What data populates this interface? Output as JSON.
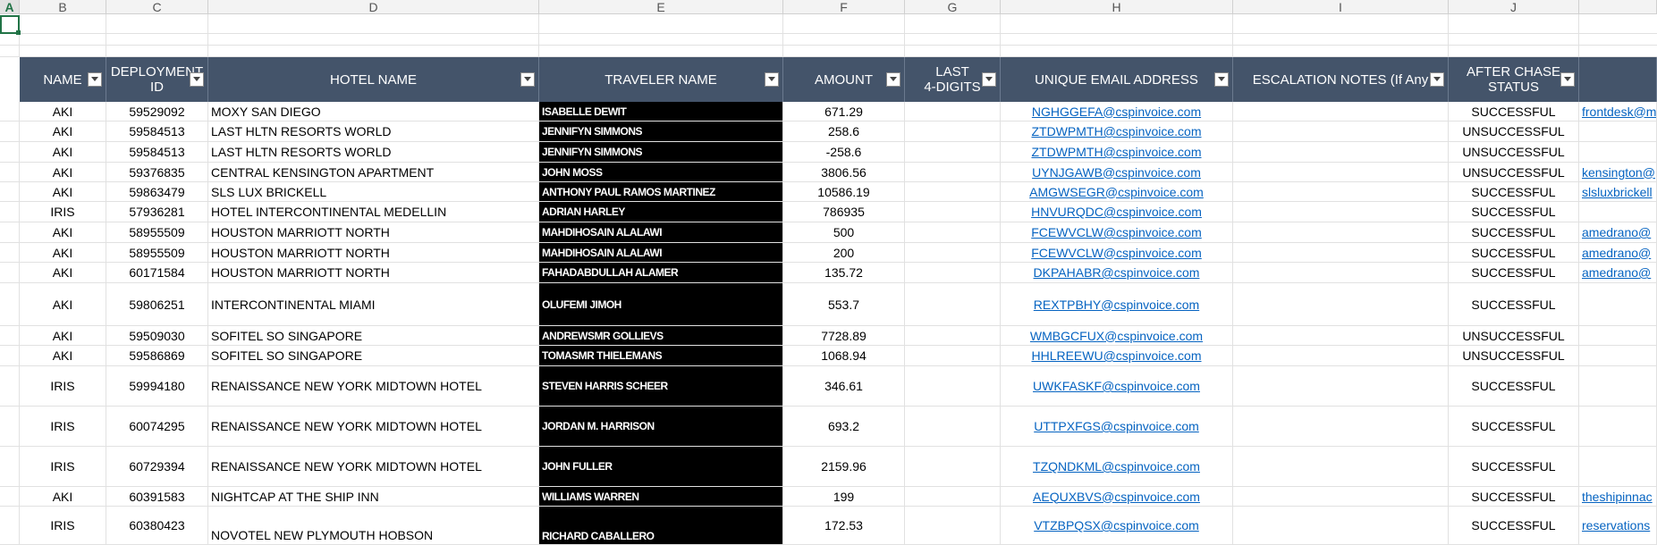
{
  "column_letters": [
    "A",
    "B",
    "C",
    "D",
    "E",
    "F",
    "G",
    "H",
    "I",
    "J"
  ],
  "table": {
    "headers": [
      {
        "key": "name",
        "label": "NAME"
      },
      {
        "key": "deployment",
        "label": "DEPLOYMENT\nID"
      },
      {
        "key": "hotel",
        "label": "HOTEL NAME"
      },
      {
        "key": "traveler",
        "label": "TRAVELER NAME"
      },
      {
        "key": "amount",
        "label": "AMOUNT"
      },
      {
        "key": "last4",
        "label": "LAST\n4-DIGITS"
      },
      {
        "key": "email",
        "label": "UNIQUE EMAIL ADDRESS"
      },
      {
        "key": "escalation",
        "label": "ESCALATION NOTES (If Any"
      },
      {
        "key": "status",
        "label": "AFTER CHASE\nSTATUS"
      },
      {
        "key": "extra",
        "label": ""
      }
    ],
    "rows": [
      {
        "name": "AKI",
        "id": "59529092",
        "hotel": "MOXY SAN DIEGO",
        "traveler": "ISABELLE DEWIT",
        "amount": "671.29",
        "email": "NGHGGEFA@cspinvoice.com",
        "status": "SUCCESSFUL",
        "contact": "frontdesk@m"
      },
      {
        "name": "AKI",
        "id": "59584513",
        "hotel": "LAST HLTN RESORTS WORLD",
        "traveler": "JENNIFYN SIMMONS",
        "amount": "258.6",
        "email": "ZTDWPMTH@cspinvoice.com",
        "status": "UNSUCCESSFUL",
        "contact": ""
      },
      {
        "name": "AKI",
        "id": "59584513",
        "hotel": "LAST HLTN RESORTS WORLD",
        "traveler": "JENNIFYN SIMMONS",
        "amount": "-258.6",
        "email": "ZTDWPMTH@cspinvoice.com",
        "status": "UNSUCCESSFUL",
        "contact": ""
      },
      {
        "name": "AKI",
        "id": "59376835",
        "hotel": "CENTRAL KENSINGTON APARTMENT",
        "traveler": "JOHN MOSS",
        "amount": "3806.56",
        "email": "UYNJGAWB@cspinvoice.com",
        "status": "UNSUCCESSFUL",
        "contact": "kensington@"
      },
      {
        "name": "AKI",
        "id": "59863479",
        "hotel": "SLS LUX BRICKELL",
        "traveler": "ANTHONY PAUL RAMOS MARTINEZ",
        "amount": "10586.19",
        "email": "AMGWSEGR@cspinvoice.com",
        "status": "SUCCESSFUL",
        "contact": "slsluxbrickell"
      },
      {
        "name": "IRIS",
        "id": "57936281",
        "hotel": "HOTEL INTERCONTINENTAL MEDELLIN",
        "traveler": "ADRIAN HARLEY",
        "amount": "786935",
        "email": "HNVURQDC@cspinvoice.com",
        "status": "SUCCESSFUL",
        "contact": ""
      },
      {
        "name": "AKI",
        "id": "58955509",
        "hotel": "HOUSTON MARRIOTT NORTH",
        "traveler": "MAHDIHOSAIN ALALAWI",
        "amount": "500",
        "email": "FCEWVCLW@cspinvoice.com",
        "status": "SUCCESSFUL",
        "contact": "amedrano@"
      },
      {
        "name": "AKI",
        "id": "58955509",
        "hotel": "HOUSTON MARRIOTT NORTH",
        "traveler": "MAHDIHOSAIN ALALAWI",
        "amount": "200",
        "email": "FCEWVCLW@cspinvoice.com",
        "status": "SUCCESSFUL",
        "contact": "amedrano@"
      },
      {
        "name": "AKI",
        "id": "60171584",
        "hotel": "HOUSTON MARRIOTT NORTH",
        "traveler": "FAHADABDULLAH ALAMER",
        "amount": "135.72",
        "email": "DKPAHABR@cspinvoice.com",
        "status": "SUCCESSFUL",
        "contact": "amedrano@"
      },
      {
        "name": "AKI",
        "id": "59806251",
        "hotel": "INTERCONTINENTAL MIAMI",
        "traveler": "OLUFEMI JIMOH",
        "amount": "553.7",
        "email": "REXTPBHY@cspinvoice.com",
        "status": "SUCCESSFUL",
        "contact": ""
      },
      {
        "name": "AKI",
        "id": "59509030",
        "hotel": "SOFITEL SO SINGAPORE",
        "traveler": "ANDREWSMR GOLLIEVS",
        "amount": "7728.89",
        "email": "WMBGCFUX@cspinvoice.com",
        "status": "UNSUCCESSFUL",
        "contact": ""
      },
      {
        "name": "AKI",
        "id": "59586869",
        "hotel": "SOFITEL SO SINGAPORE",
        "traveler": "TOMASMR THIELEMANS",
        "amount": "1068.94",
        "email": "HHLREEWU@cspinvoice.com",
        "status": "UNSUCCESSFUL",
        "contact": ""
      },
      {
        "name": "IRIS",
        "id": "59994180",
        "hotel": "RENAISSANCE NEW YORK MIDTOWN HOTEL",
        "traveler": "STEVEN HARRIS SCHEER",
        "amount": "346.61",
        "email": "UWKFASKF@cspinvoice.com",
        "status": "SUCCESSFUL",
        "contact": ""
      },
      {
        "name": "IRIS",
        "id": "60074295",
        "hotel": "RENAISSANCE NEW YORK MIDTOWN HOTEL",
        "traveler": "JORDAN M. HARRISON",
        "amount": "693.2",
        "email": "UTTPXFGS@cspinvoice.com",
        "status": "SUCCESSFUL",
        "contact": ""
      },
      {
        "name": "IRIS",
        "id": "60729394",
        "hotel": "RENAISSANCE NEW YORK MIDTOWN HOTEL",
        "traveler": "JOHN FULLER",
        "amount": "2159.96",
        "email": "TZQNDKML@cspinvoice.com",
        "status": "SUCCESSFUL",
        "contact": ""
      },
      {
        "name": "AKI",
        "id": "60391583",
        "hotel": "NIGHTCAP AT THE SHIP INN",
        "traveler": "WILLIAMS WARREN",
        "amount": "199",
        "email": "AEQUXBVS@cspinvoice.com",
        "status": "SUCCESSFUL",
        "contact": "theshipinnac"
      },
      {
        "name": "IRIS",
        "id": "60380423",
        "hotel": "NOVOTEL NEW PLYMOUTH HOBSON",
        "traveler": "RICHARD CABALLERO",
        "amount": "172.53",
        "email": "VTZBPQSX@cspinvoice.com",
        "status": "SUCCESSFUL",
        "contact": "reservations"
      }
    ]
  }
}
